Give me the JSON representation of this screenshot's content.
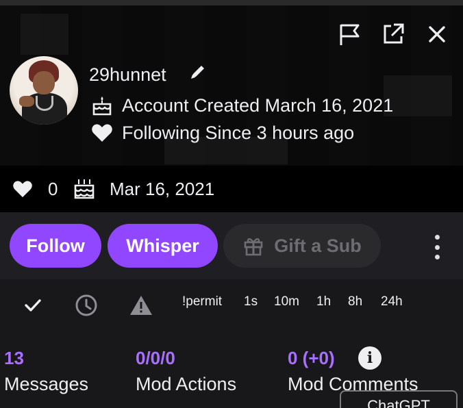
{
  "header": {
    "username": "29hunnet",
    "account_created": "Account Created March 16, 2021",
    "following_since": "Following Since 3 hours ago"
  },
  "stats": {
    "follows_count": "0",
    "created_short": "Mar 16, 2021"
  },
  "actions": {
    "follow_label": "Follow",
    "whisper_label": "Whisper",
    "gift_label": "Gift a Sub"
  },
  "moderation": {
    "timeouts": [
      "!permit",
      "1s",
      "10m",
      "1h",
      "8h",
      "24h"
    ]
  },
  "counts": {
    "messages_value": "13",
    "messages_label": "Messages",
    "mod_actions_value": "0/0/0",
    "mod_actions_label": "Mod Actions",
    "mod_comments_value": "0 (+0)",
    "mod_comments_label": "Mod Comments"
  },
  "overlay": {
    "chatgpt_label": "ChatGPT"
  },
  "icons": {
    "report": "flag-icon",
    "popout": "external-link-icon",
    "close": "close-icon",
    "edit": "pencil-icon",
    "created": "cake-icon",
    "following": "heart-icon",
    "gift": "gift-icon",
    "more": "kebab-icon",
    "unban": "check-icon",
    "timeout": "clock-icon",
    "warn": "warning-icon",
    "info": "info-icon"
  },
  "colors": {
    "accent": "#9147ff",
    "count_value": "#a970ff",
    "background": "#18181b"
  }
}
